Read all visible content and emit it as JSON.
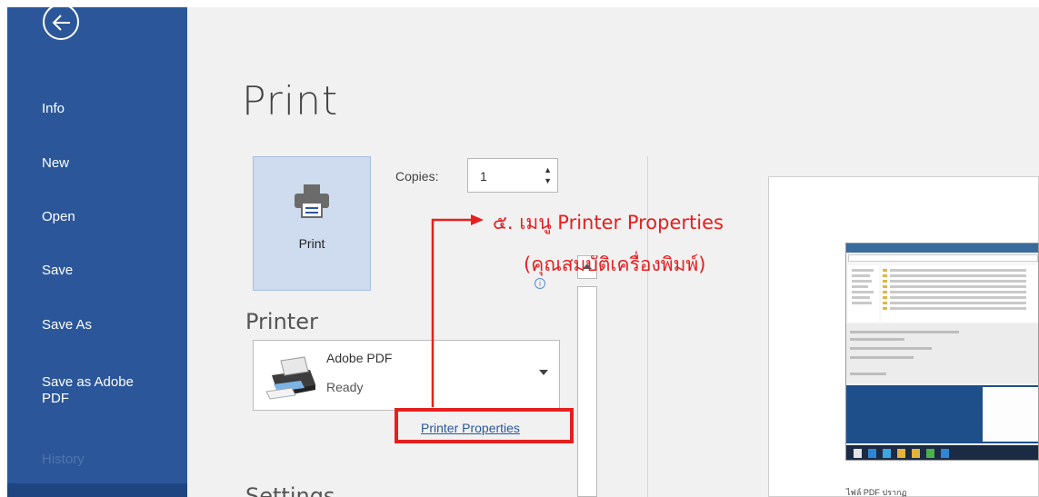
{
  "sidebar": {
    "items": [
      {
        "label": "Info"
      },
      {
        "label": "New"
      },
      {
        "label": "Open"
      },
      {
        "label": "Save"
      },
      {
        "label": "Save As"
      },
      {
        "label": "Save as Adobe"
      },
      {
        "label": "PDF"
      },
      {
        "label": "History"
      }
    ]
  },
  "page_title": "Print",
  "print_button_label": "Print",
  "copies": {
    "label": "Copies:",
    "value": "1"
  },
  "printer_section": {
    "heading": "Printer",
    "selected_printer": "Adobe PDF",
    "status": "Ready",
    "properties_link": "Printer Properties"
  },
  "settings_heading": "Settings",
  "annotation": {
    "line1": "๕. เมนู Printer Properties",
    "line2": "(คุณสมบัติเครื่องพิมพ์)",
    "color": "#e61f1f"
  },
  "preview_caption": "ไฟล์ PDF ปรากฏ",
  "colors": {
    "sidebar": "#2b579a",
    "accent": "#2b579a"
  }
}
